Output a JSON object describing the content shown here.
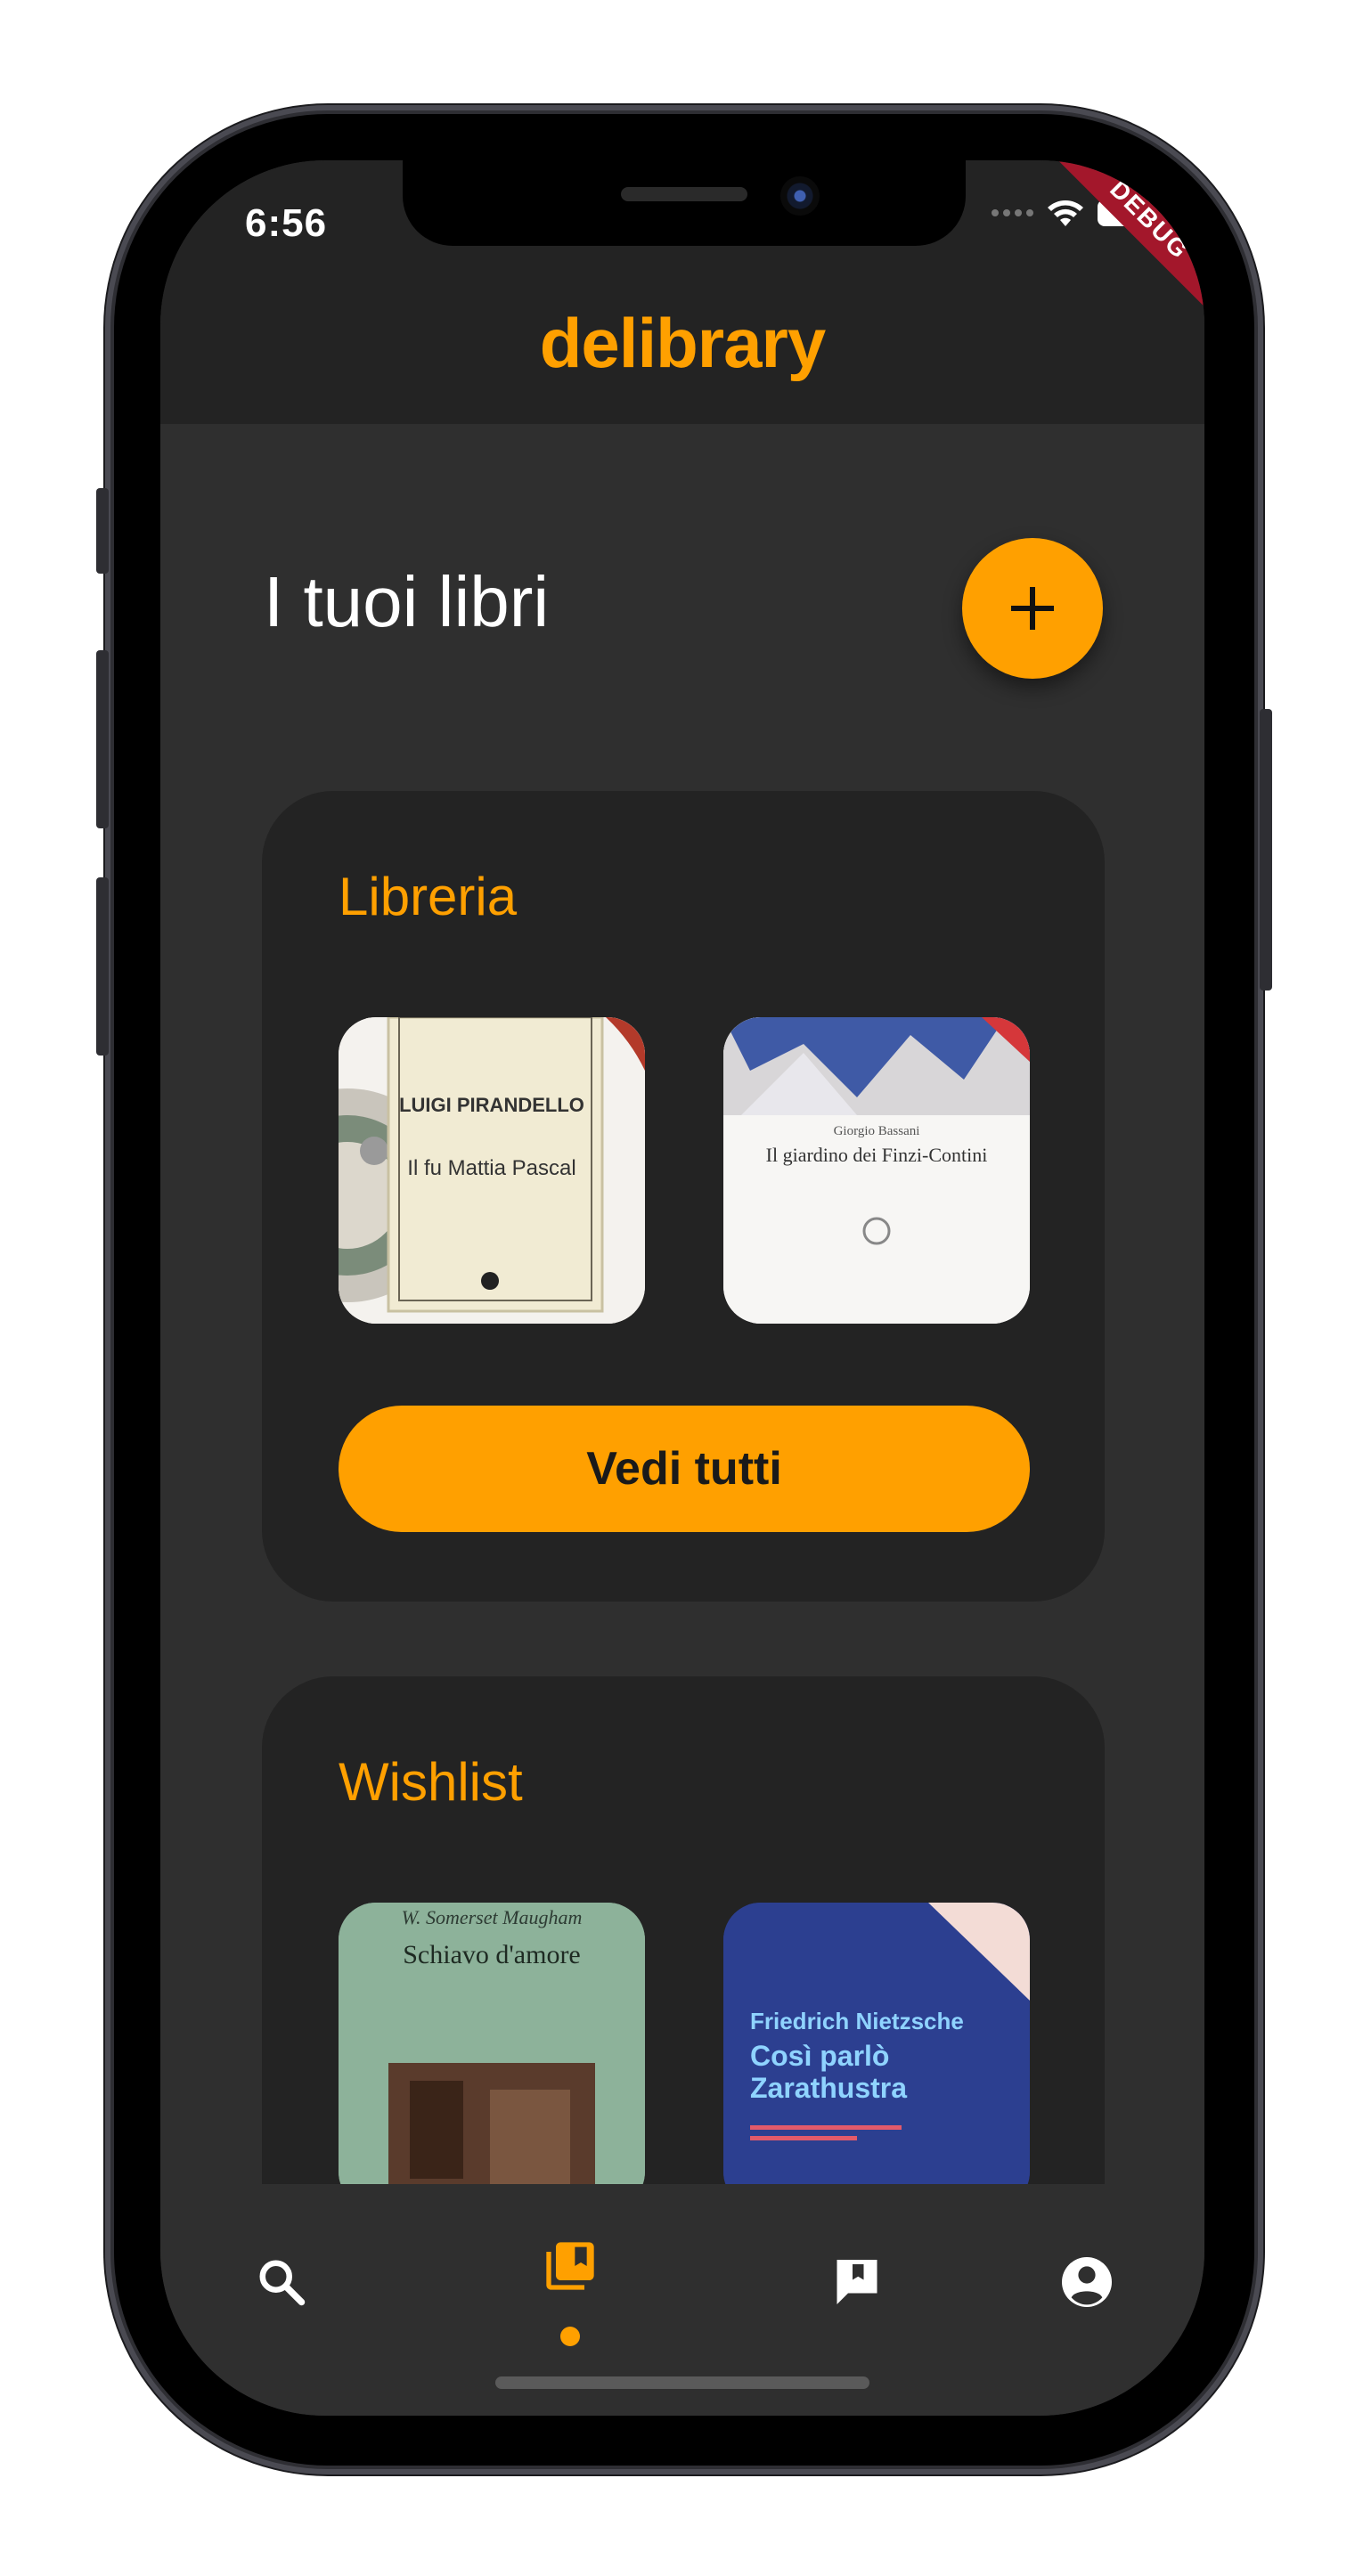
{
  "status_bar": {
    "time": "6:56",
    "debug_banner": "DEBUG"
  },
  "app_bar": {
    "title": "delibrary"
  },
  "page": {
    "heading": "I tuoi libri",
    "add_button": "+"
  },
  "library_card": {
    "title": "Libreria",
    "books": [
      {
        "author": "LUIGI PIRANDELLO",
        "title": "Il fu Mattia Pascal"
      },
      {
        "author": "Giorgio Bassani",
        "title": "Il giardino dei Finzi-Contini"
      }
    ],
    "see_all_label": "Vedi tutti"
  },
  "wishlist_card": {
    "title": "Wishlist",
    "books": [
      {
        "author": "W. Somerset Maugham",
        "title": "Schiavo d'amore"
      },
      {
        "author": "Friedrich Nietzsche",
        "title": "Così parlò Zarathustra"
      }
    ]
  },
  "bottom_nav": {
    "items": [
      {
        "icon": "search-icon"
      },
      {
        "icon": "library-books-icon",
        "active": true
      },
      {
        "icon": "bookmark-icon"
      },
      {
        "icon": "account-circle-icon"
      }
    ],
    "accent_color": "#ffa000"
  },
  "colors": {
    "accent": "#ffa000",
    "background": "#2f2f2f",
    "card": "#232323"
  }
}
